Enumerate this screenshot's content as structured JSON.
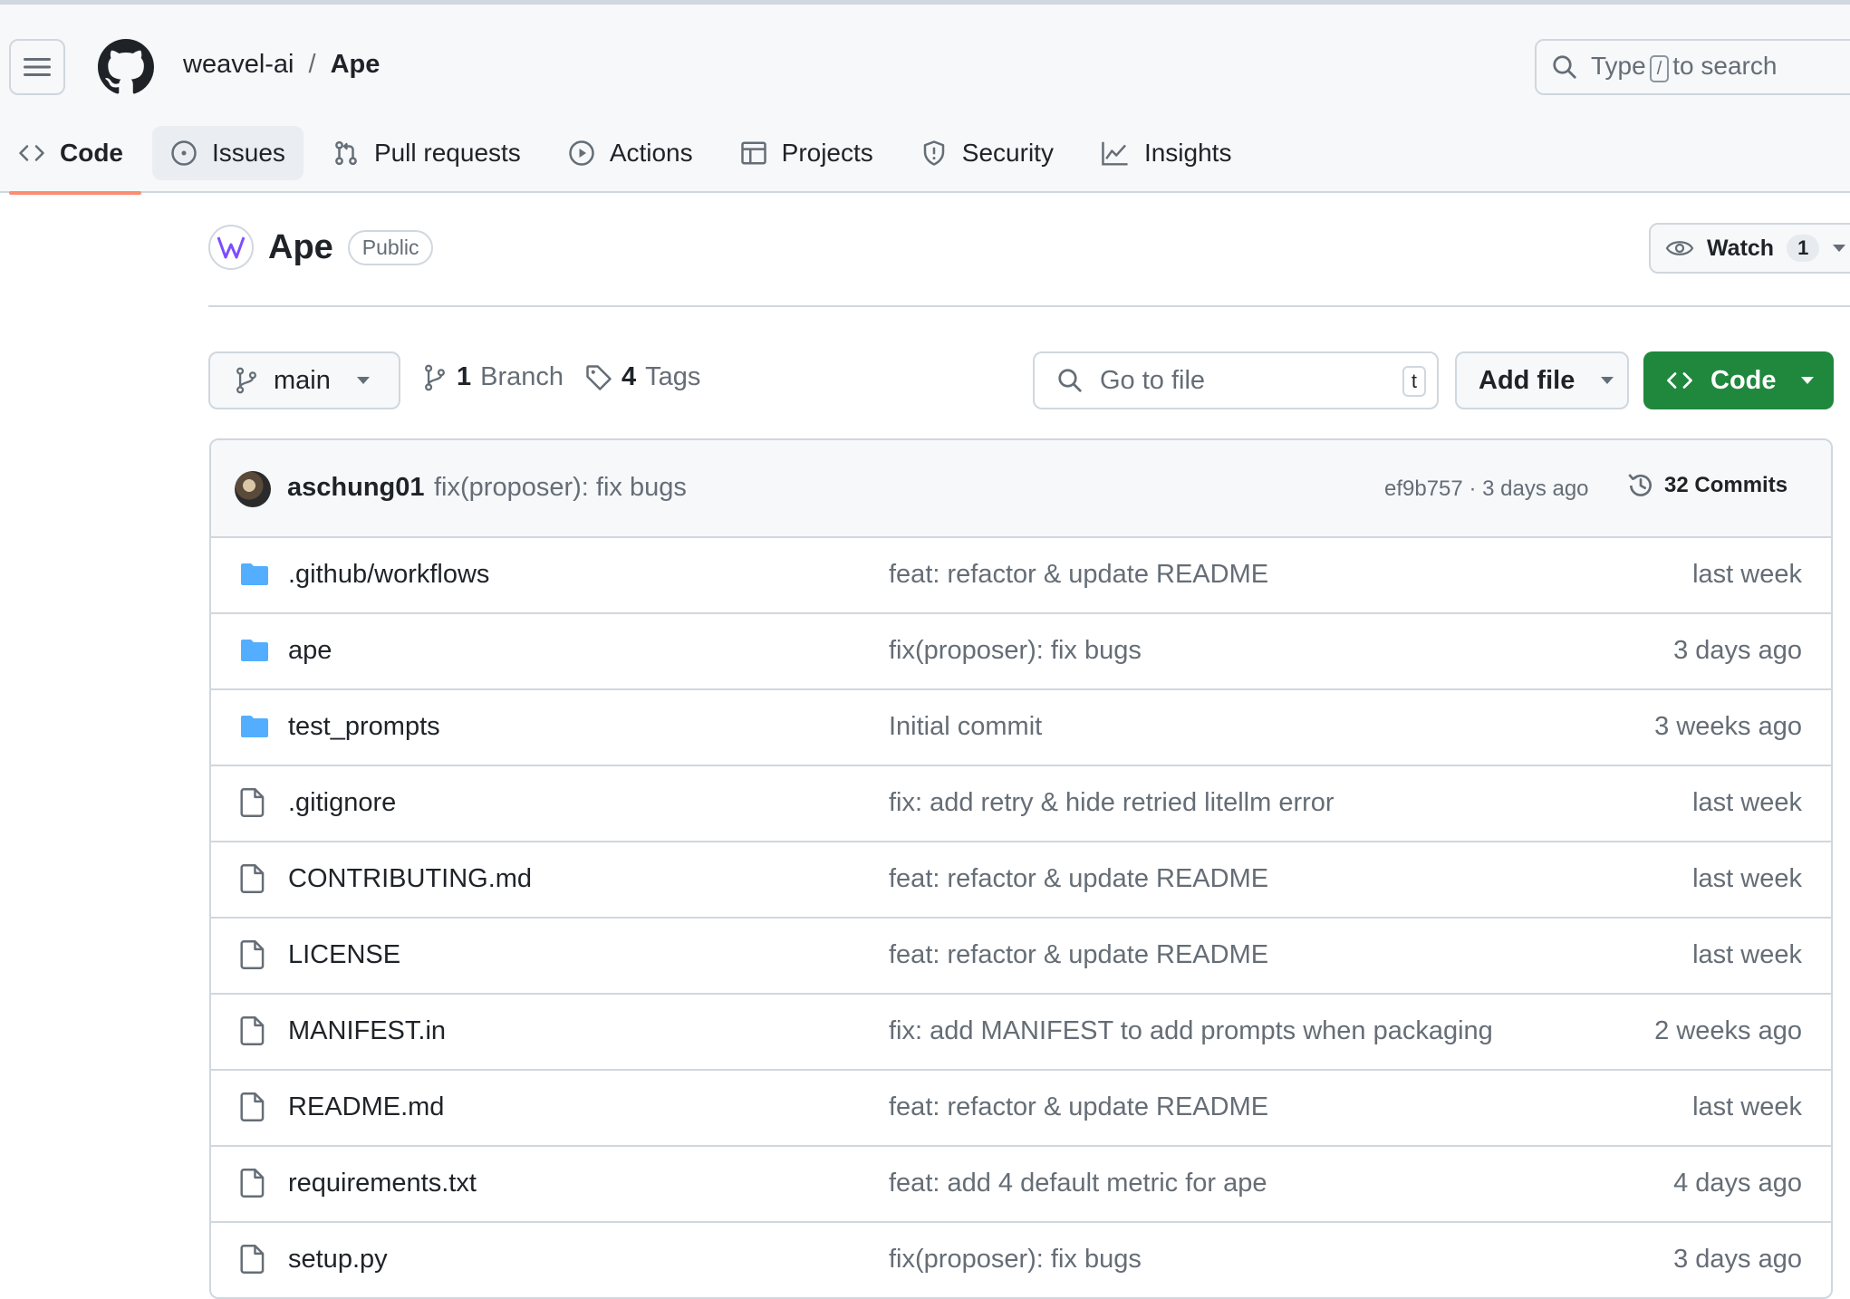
{
  "header": {
    "owner": "weavel-ai",
    "separator": "/",
    "repo": "Ape",
    "search_type": "Type",
    "search_key": "/",
    "search_rest": "to search"
  },
  "nav": {
    "tabs": [
      {
        "label": "Code",
        "icon": "code-icon",
        "active": true
      },
      {
        "label": "Issues",
        "icon": "issue-icon"
      },
      {
        "label": "Pull requests",
        "icon": "pull-request-icon"
      },
      {
        "label": "Actions",
        "icon": "play-icon"
      },
      {
        "label": "Projects",
        "icon": "table-icon"
      },
      {
        "label": "Security",
        "icon": "shield-icon"
      },
      {
        "label": "Insights",
        "icon": "graph-icon"
      }
    ]
  },
  "repo": {
    "name": "Ape",
    "visibility": "Public",
    "watch_label": "Watch",
    "watch_count": "1"
  },
  "toolbar": {
    "branch": "main",
    "branch_count": "1",
    "branch_label": "Branch",
    "tag_count": "4",
    "tag_label": "Tags",
    "goto_placeholder": "Go to file",
    "goto_key": "t",
    "add_file": "Add file",
    "code": "Code"
  },
  "latest_commit": {
    "author": "aschung01",
    "message": "fix(proposer): fix bugs",
    "hash": "ef9b757",
    "dot": "·",
    "time": "3 days ago",
    "commits_label": "32 Commits"
  },
  "files": [
    {
      "type": "folder",
      "name": ".github/workflows",
      "message": "feat: refactor & update README",
      "date": "last week"
    },
    {
      "type": "folder",
      "name": "ape",
      "message": "fix(proposer): fix bugs",
      "date": "3 days ago"
    },
    {
      "type": "folder",
      "name": "test_prompts",
      "message": "Initial commit",
      "date": "3 weeks ago"
    },
    {
      "type": "file",
      "name": ".gitignore",
      "message": "fix: add retry & hide retried litellm error",
      "date": "last week"
    },
    {
      "type": "file",
      "name": "CONTRIBUTING.md",
      "message": "feat: refactor & update README",
      "date": "last week"
    },
    {
      "type": "file",
      "name": "LICENSE",
      "message": "feat: refactor & update README",
      "date": "last week"
    },
    {
      "type": "file",
      "name": "MANIFEST.in",
      "message": "fix: add MANIFEST to add prompts when packaging",
      "date": "2 weeks ago"
    },
    {
      "type": "file",
      "name": "README.md",
      "message": "feat: refactor & update README",
      "date": "last week"
    },
    {
      "type": "file",
      "name": "requirements.txt",
      "message": "feat: add 4 default metric for ape",
      "date": "4 days ago"
    },
    {
      "type": "file",
      "name": "setup.py",
      "message": "fix(proposer): fix bugs",
      "date": "3 days ago"
    }
  ],
  "colors": {
    "accent_green": "#1f883d",
    "tab_underline": "#fd8c73",
    "folder_blue": "#54aeff",
    "muted_text": "#656d76"
  }
}
